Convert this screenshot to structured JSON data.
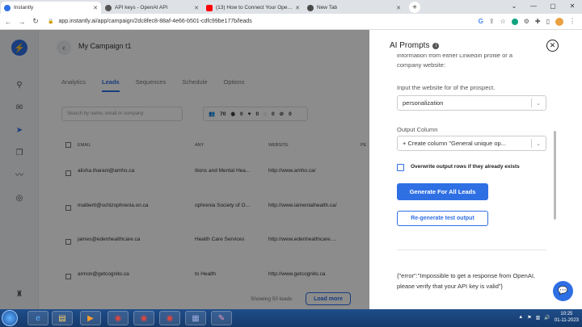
{
  "browser": {
    "tabs": [
      {
        "title": "Instantly",
        "color": "#2f6fe4",
        "active": true
      },
      {
        "title": "API keys - OpenAI API",
        "color": "#555555",
        "active": false
      },
      {
        "title": "(13) How to Connect Your OpenAI",
        "color": "#ff0000",
        "active": false
      },
      {
        "title": "New Tab",
        "color": "#4a4a4a",
        "active": false
      }
    ],
    "url": "app.instantly.ai/app/campaign/2dc8fec8-88af-4e66-b501-cdfc99be177b/leads"
  },
  "app": {
    "campaign_name": "My Campaign t1",
    "tabs": [
      "Analytics",
      "Leads",
      "Sequences",
      "Schedule",
      "Options"
    ],
    "active_tab": "Leads",
    "search_placeholder": "Search by name, email or company",
    "stats": [
      "70",
      "0",
      "0",
      "0",
      "0"
    ],
    "table": {
      "headers": [
        "EMAIL",
        "ANY",
        "WEBSITE",
        "PE"
      ],
      "rows": [
        {
          "email": "alisha.tharani@amho.ca",
          "company": "itions and Mental Hea...",
          "website": "http://www.amho.ca/"
        },
        {
          "email": "malberti@schizophrenia.on.ca",
          "company": "ophrenia Society of O...",
          "website": "http://www.iamentalhealth.ca/"
        },
        {
          "email": "james@edenhealthcare.ca",
          "company": "Health Care Services",
          "website": "http://www.edenhealthcare...."
        },
        {
          "email": "armon@getcognito.ca",
          "company": "to Health",
          "website": "http://www.getcognito.ca"
        }
      ]
    },
    "showing": "Showing 50 leads",
    "load_more": "Load more"
  },
  "panel": {
    "title": "AI Prompts",
    "cut_text": "information from either LinkedIn profile or a",
    "desc": "company website:",
    "input_label": "Input the website for of the prospect.",
    "input_value": "personalization",
    "output_label": "Output Column",
    "output_value": "+ Create column \"General unique op...",
    "checkbox_label": "Overwrite output rows if they already exists",
    "generate_btn": "Generate For All Leads",
    "regenerate_btn": "Re-generate test output",
    "error_text": "{\"error\":\"Impossible to get a response from OpenAI, please verify that your API key is valid\"}"
  },
  "taskbar": {
    "time": "10:25",
    "date": "01-11-2023"
  }
}
